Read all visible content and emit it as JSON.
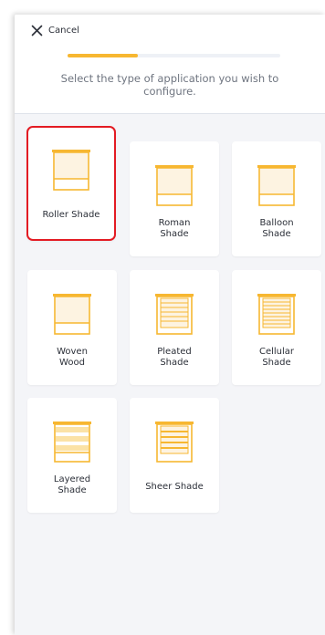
{
  "header": {
    "cancel_label": "Cancel",
    "progress": 0.33,
    "instruction": "Select the type of application you wish to configure."
  },
  "colors": {
    "accent": "#f7b731",
    "selected_border": "#e31b23"
  },
  "products": [
    {
      "label": "Roller Shade",
      "icon": "roller-shade-icon",
      "selected": true
    },
    {
      "label": "Roman\nShade",
      "icon": "roman-shade-icon"
    },
    {
      "label": "Balloon\nShade",
      "icon": "balloon-shade-icon"
    },
    {
      "label": "Woven\nWood",
      "icon": "woven-wood-icon"
    },
    {
      "label": "Pleated\nShade",
      "icon": "pleated-shade-icon"
    },
    {
      "label": "Cellular\nShade",
      "icon": "cellular-shade-icon"
    },
    {
      "label": "Layered\nShade",
      "icon": "layered-shade-icon"
    },
    {
      "label": "Sheer Shade",
      "icon": "sheer-shade-icon"
    }
  ]
}
